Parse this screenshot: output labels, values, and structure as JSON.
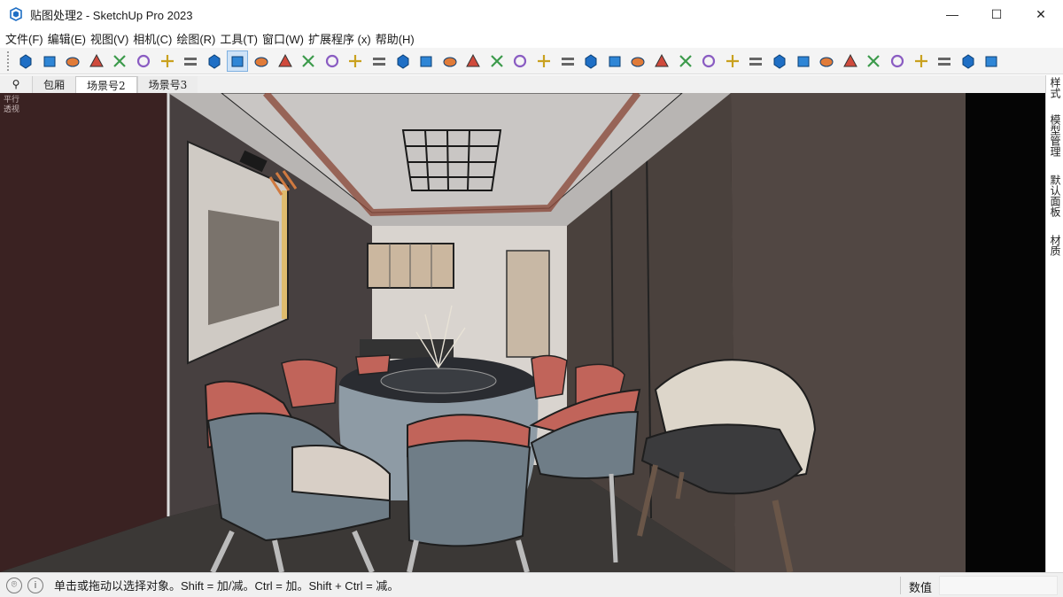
{
  "window": {
    "title": "贴图处理2 - SketchUp Pro 2023",
    "minimize": "—",
    "maximize": "☐",
    "close": "✕"
  },
  "menu": [
    "文件(F)",
    "编辑(E)",
    "视图(V)",
    "相机(C)",
    "绘图(R)",
    "工具(T)",
    "窗口(W)",
    "扩展程序 (x)",
    "帮助(H)"
  ],
  "toolbar_icons": [
    "component-cube-icon",
    "box-icon",
    "ellipsoid-icon",
    "push-pull-face-icon",
    "move-box-icon",
    "group-stack-icon",
    "frame-icon",
    "sword-tool-icon",
    "layer-stack-icon",
    "section-box-icon",
    "spiral-icon",
    "select-arrow-icon",
    "move-cross-icon",
    "rotate-icon",
    "scale-icon",
    "tape-measure-icon",
    "wireframe-icon",
    "solid-shell-icon",
    "material-box-icon",
    "extension-gem-icon",
    "paint-bucket-icon",
    "gear-icon",
    "line-node-icon",
    "diagonal-line-icon",
    "crossed-lines-icon",
    "bent-line-icon",
    "grid-nodes-icon",
    "rect-nodes-icon",
    "crossed-rect-icon",
    "align-horizontal-icon",
    "align-center-icon",
    "distribute-icon",
    "flip-down-icon",
    "delete-lines-icon",
    "panel-layout-icon",
    "grid-view-icon",
    "blue-grid-icon",
    "hatch-grid-icon",
    "hatch-grid-2-icon",
    "cube-grid-icon",
    "red-frame-icon",
    "triangle-tool-icon"
  ],
  "active_tool_index": 9,
  "scene_tabs": {
    "search_icon": "⚲",
    "tabs": [
      "包厢",
      "场景号2",
      "场景号3"
    ],
    "active_index": 1
  },
  "tray_tabs": [
    "样式",
    "模型管理",
    "默认面板",
    "材质"
  ],
  "viewport": {
    "corner_text": [
      "平行",
      "透视"
    ]
  },
  "status": {
    "message": "单击或拖动以选择对象。Shift = 加/减。Ctrl = 加。Shift + Ctrl = 减。",
    "measure_label": "数值",
    "measure_value": ""
  }
}
